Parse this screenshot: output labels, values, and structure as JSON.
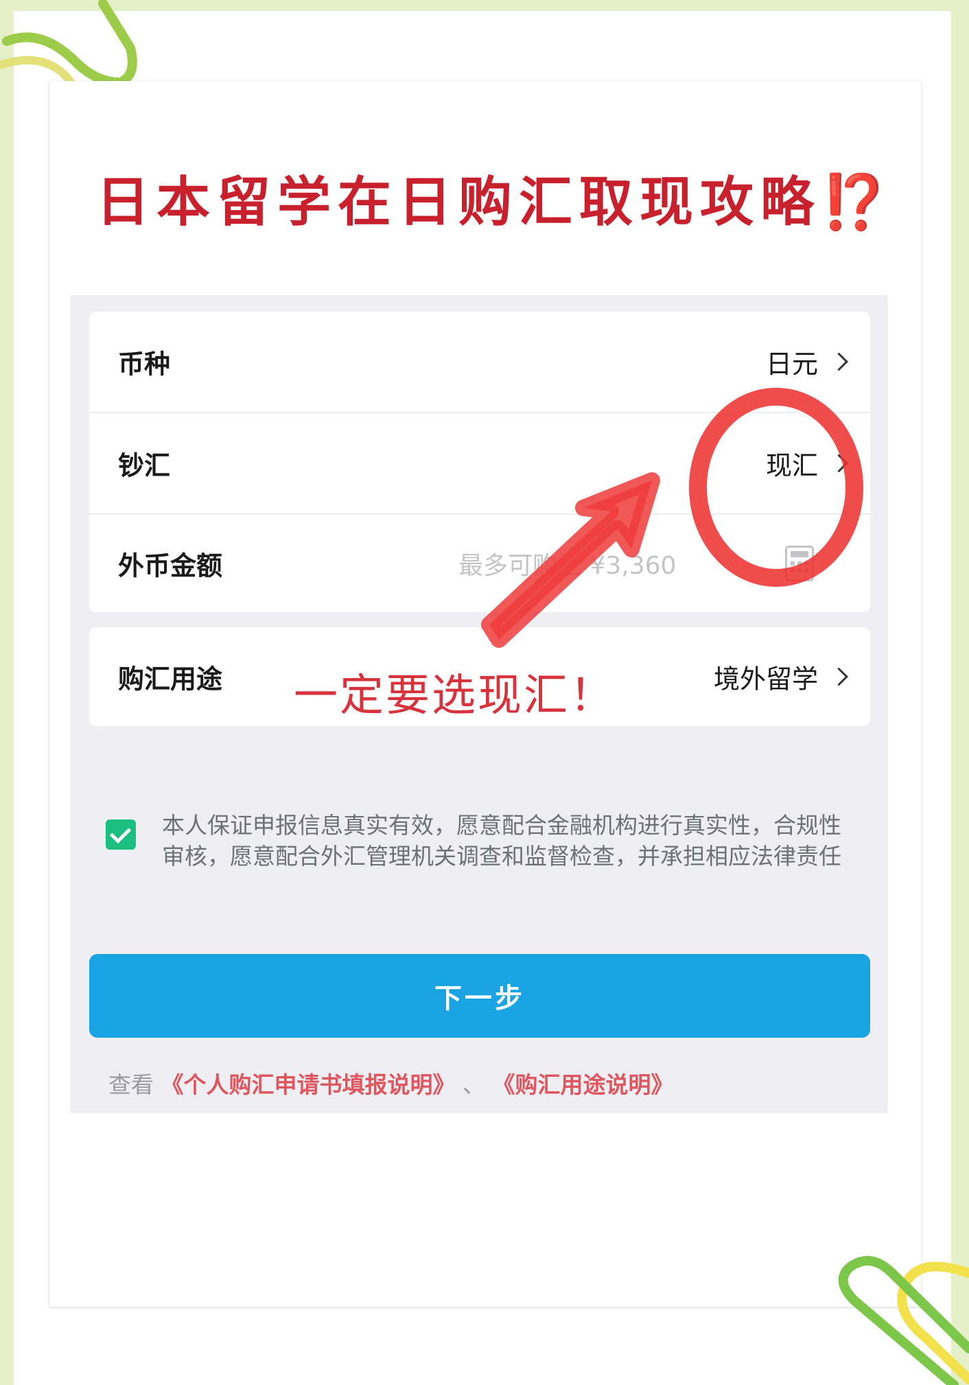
{
  "headline": {
    "text": "日本留学在日购汇取现攻略",
    "mark": "⁉️"
  },
  "form": {
    "currency": {
      "label": "币种",
      "value": "日元"
    },
    "cash_type": {
      "label": "钞汇",
      "value": "现汇"
    },
    "amount": {
      "label": "外币金额",
      "placeholder": "最多可购汇 ¥3,360"
    },
    "purpose": {
      "label": "购汇用途",
      "value": "境外留学"
    }
  },
  "annotation": {
    "text": "一定要选现汇！"
  },
  "declaration": {
    "checked": true,
    "text": "本人保证申报信息真实有效，愿意配合金融机构进行真实性，合规性审核，愿意配合外汇管理机关调查和监督检查，并承担相应法律责任"
  },
  "next_button": {
    "label": "下一步"
  },
  "footer": {
    "prefix": "查看",
    "link1": "《个人购汇申请书填报说明》",
    "separator": "、",
    "link2": "《购汇用途说明》"
  },
  "colors": {
    "accent": "#1aa3e3",
    "check": "#1bbf80",
    "annotation": "#d8323d",
    "link": "#e0565e"
  }
}
